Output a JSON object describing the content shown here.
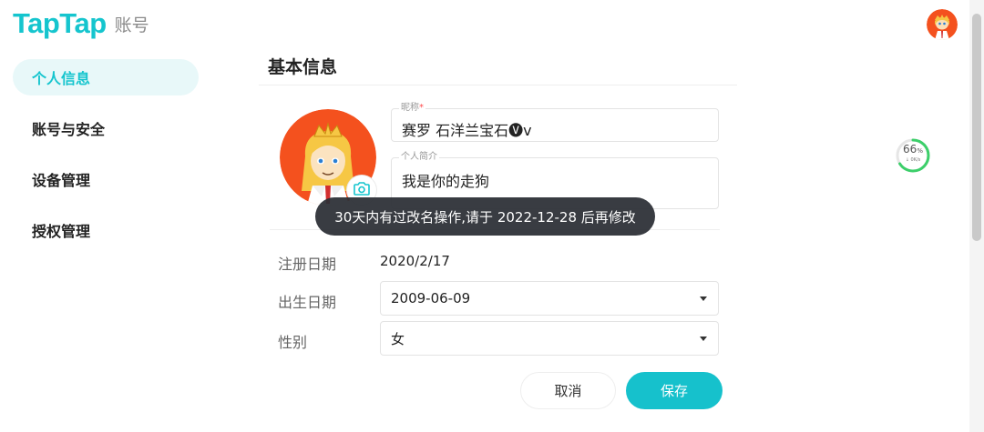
{
  "brand": {
    "logo": "TapTap",
    "section": "账号"
  },
  "sidebar": {
    "items": [
      {
        "label": "个人信息",
        "active": true
      },
      {
        "label": "账号与安全",
        "active": false
      },
      {
        "label": "设备管理",
        "active": false
      },
      {
        "label": "授权管理",
        "active": false
      }
    ]
  },
  "main": {
    "title": "基本信息",
    "nickname": {
      "label": "昵称",
      "required_mark": "*",
      "value": "赛罗 石洋兰宝石🅥v"
    },
    "bio": {
      "label": "个人简介",
      "value": "我是你的走狗"
    },
    "register_date": {
      "label": "注册日期",
      "value": "2020/2/17"
    },
    "birth_date": {
      "label": "出生日期",
      "value": "2009-06-09"
    },
    "gender": {
      "label": "性别",
      "value": "女"
    },
    "buttons": {
      "cancel": "取消",
      "save": "保存"
    }
  },
  "toast": {
    "message": "30天内有过改名操作,请于 2022-12-28 后再修改"
  },
  "speed_widget": {
    "percent": "66",
    "percent_sign": "%",
    "rate": "0K/s",
    "arrow": "↓"
  },
  "colors": {
    "accent": "#15c5ce",
    "save_button": "#16c1cc",
    "active_nav_bg": "#e8f8f9",
    "toast_bg": "#2d3036"
  }
}
